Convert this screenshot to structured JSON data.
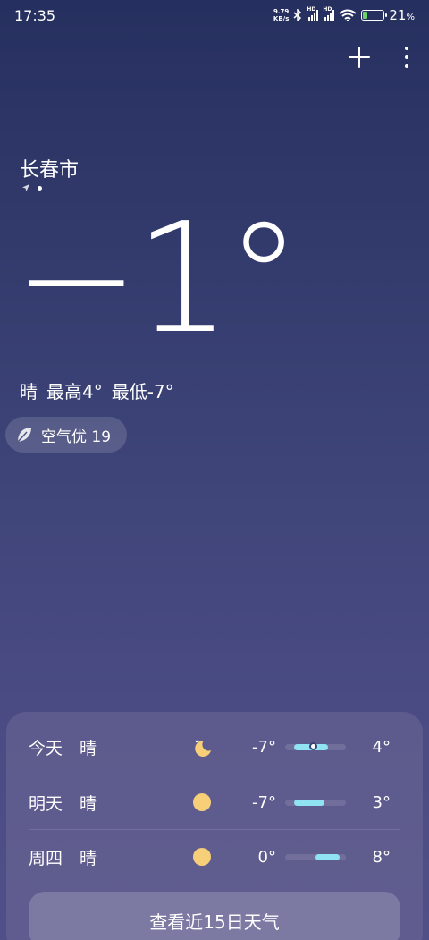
{
  "status": {
    "time": "17:35",
    "net_speed_value": "9.79",
    "net_speed_unit": "KB/s",
    "hd1": "HD",
    "hd2": "HD",
    "battery_pct": "21",
    "battery_unit": "%",
    "battery_level": 0.21,
    "icons": [
      "bluetooth-icon",
      "signal-icon",
      "signal-icon",
      "wifi-icon",
      "battery-charging-icon"
    ]
  },
  "top": {
    "icons": [
      "plus-icon",
      "more-vertical-icon"
    ]
  },
  "location": {
    "city": "长春市",
    "icons": [
      "location-arrow-icon"
    ]
  },
  "current": {
    "temperature": "−1°",
    "condition": "晴",
    "high": "最高4°",
    "low": "最低-7°"
  },
  "aqi": {
    "label": "空气优 19",
    "icon": "leaf-icon"
  },
  "forecast": [
    {
      "day": "今天",
      "condition": "晴",
      "icon": "moon-icon",
      "low": "-7°",
      "high": "4°",
      "low_value": -7,
      "high_value": 4,
      "current_value": -1
    },
    {
      "day": "明天",
      "condition": "晴",
      "icon": "sun-icon",
      "low": "-7°",
      "high": "3°",
      "low_value": -7,
      "high_value": 3
    },
    {
      "day": "周四",
      "condition": "晴",
      "icon": "sun-icon",
      "low": "0°",
      "high": "8°",
      "low_value": 0,
      "high_value": 8
    }
  ],
  "forecast_range": [
    -10,
    10
  ],
  "button_15day": "查看近15日天气",
  "colors": {
    "bar": "#8fe3f2",
    "sun": "#f6cf78",
    "battery": "#6bd36b"
  }
}
